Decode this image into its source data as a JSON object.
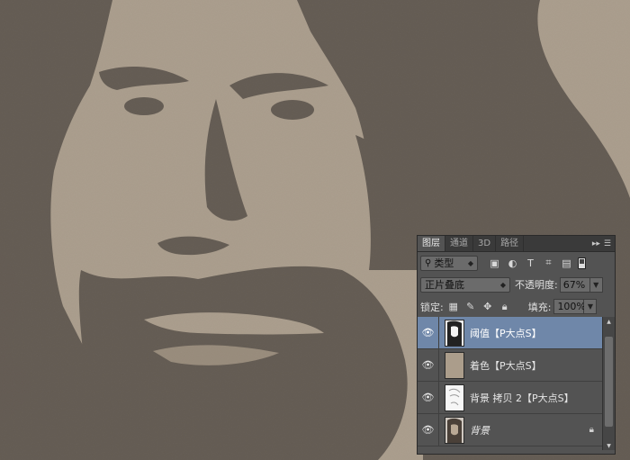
{
  "layers_panel": {
    "tabs": [
      {
        "label": "图层",
        "active": true
      },
      {
        "label": "通道",
        "active": false
      },
      {
        "label": "3D",
        "active": false
      },
      {
        "label": "路径",
        "active": false
      }
    ],
    "filter": {
      "label": "类型"
    },
    "blend_mode": {
      "value": "正片叠底"
    },
    "opacity": {
      "label": "不透明度:",
      "value": "67%"
    },
    "lock": {
      "label": "锁定:"
    },
    "fill": {
      "label": "填充:",
      "value": "100%"
    },
    "layers": [
      {
        "name": "阈值【P大点S】",
        "selected": true,
        "italic": false,
        "locked": false
      },
      {
        "name": "着色【P大点S】",
        "selected": false,
        "italic": false,
        "locked": false
      },
      {
        "name": "背景 拷贝 2【P大点S】",
        "selected": false,
        "italic": false,
        "locked": false
      },
      {
        "name": "背景",
        "selected": false,
        "italic": true,
        "locked": true
      }
    ],
    "colors": {
      "selected": "#6f87a9",
      "panel": "#535353",
      "tan": "#ab9d8b"
    }
  }
}
